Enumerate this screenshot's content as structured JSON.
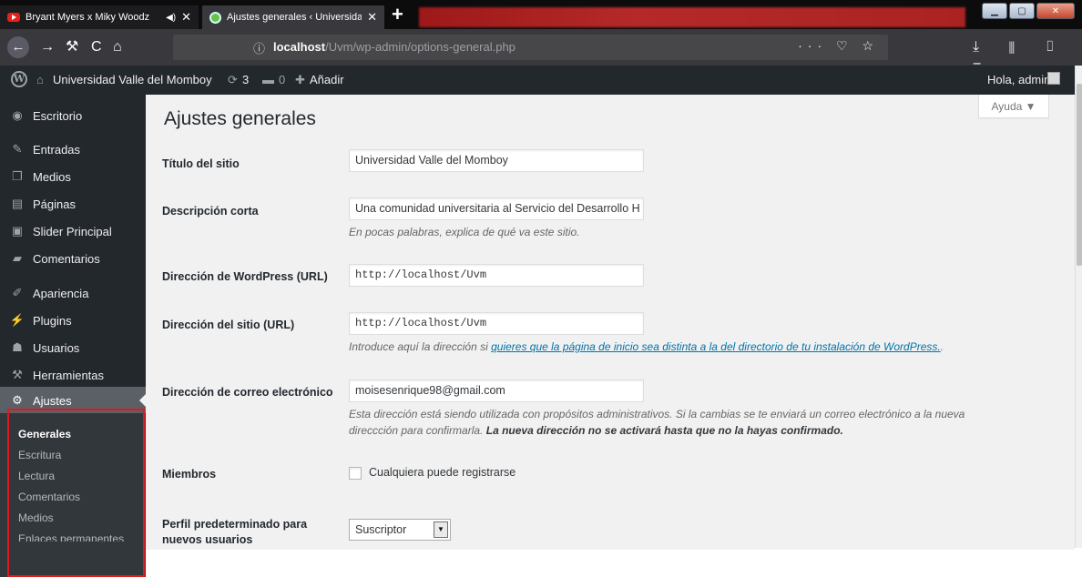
{
  "browser": {
    "tabs": [
      {
        "label": "Bryant Myers x Miky Woodz",
        "icon": "youtube-icon",
        "audio": true
      },
      {
        "label": "Ajustes generales ‹ Universidad",
        "icon": "globe-icon"
      }
    ],
    "url_host": "localhost",
    "url_path": "/Uvm/wp-admin/options-general.php",
    "url_actions": "··· ♡ ☆",
    "nav_back": "←",
    "nav_forward": "→",
    "nav_reload": "C",
    "nav_home": "⌂",
    "nav_tools": "⚒",
    "toolbar_right": "⤓ ⫴ ▯ ≡",
    "new_tab": "+",
    "window_controls": {
      "minimize": "▁",
      "maximize": "▢",
      "close": "✕"
    }
  },
  "adminbar": {
    "site_name": "Universidad Valle del Momboy",
    "updates_count": "3",
    "comments_count": "0",
    "new_label": "Añadir",
    "greeting": "Hola, admin"
  },
  "sidebar": {
    "items": [
      {
        "label": "Escritorio",
        "icon": "dashboard-icon",
        "glyph": "◉"
      },
      {
        "label": "Entradas",
        "icon": "pin-icon",
        "glyph": "✎"
      },
      {
        "label": "Medios",
        "icon": "media-icon",
        "glyph": "❐"
      },
      {
        "label": "Páginas",
        "icon": "pages-icon",
        "glyph": "▤"
      },
      {
        "label": "Slider Principal",
        "icon": "slider-icon",
        "glyph": "▣"
      },
      {
        "label": "Comentarios",
        "icon": "comments-icon",
        "glyph": "▰"
      },
      {
        "label": "Apariencia",
        "icon": "brush-icon",
        "glyph": "✐"
      },
      {
        "label": "Plugins",
        "icon": "plug-icon",
        "glyph": "⚡"
      },
      {
        "label": "Usuarios",
        "icon": "users-icon",
        "glyph": "☗"
      },
      {
        "label": "Herramientas",
        "icon": "wrench-icon",
        "glyph": "⚒"
      },
      {
        "label": "Ajustes",
        "icon": "settings-icon",
        "glyph": "⚙"
      }
    ],
    "submenu": [
      "Generales",
      "Escritura",
      "Lectura",
      "Comentarios",
      "Medios",
      "Enlaces permanentes"
    ]
  },
  "main": {
    "help_label": "Ayuda ▼",
    "page_title": "Ajustes generales",
    "fields": {
      "site_title": {
        "label": "Título del sitio",
        "value": "Universidad Valle del Momboy"
      },
      "tagline": {
        "label": "Descripción corta",
        "value": "Una comunidad universitaria al Servicio del Desarrollo H",
        "desc": "En pocas palabras, explica de qué va este sitio."
      },
      "wp_url": {
        "label": "Dirección de WordPress (URL)",
        "value": "http://localhost/Uvm"
      },
      "site_url": {
        "label": "Dirección del sitio (URL)",
        "value": "http://localhost/Uvm",
        "desc_prefix": "Introduce aquí la dirección si ",
        "desc_link": "quieres que la página de inicio sea distinta a la del directorio de tu instalación de WordPress.",
        "desc_suffix": "."
      },
      "admin_email": {
        "label": "Dirección de correo electrónico",
        "value": "moisesenrique98@gmail.com",
        "desc_line1": "Esta dirección está siendo utilizada con propósitos administrativos. Si la cambias se te enviará un correo electrónico a la nueva",
        "desc_line2_prefix": "direccción para confirmarla. ",
        "desc_line2_bold": "La nueva dirección no se activará hasta que no la hayas confirmado."
      },
      "membership": {
        "label": "Miembros",
        "checkbox_label": "Cualquiera puede registrarse",
        "checked": false
      },
      "default_role": {
        "label_line1": "Perfil predeterminado para",
        "label_line2": "nuevos usuarios",
        "value": "Suscriptor"
      }
    }
  },
  "colors": {
    "wp_sidebar": "#23282d",
    "wp_submenu": "#32373c",
    "wp_active": "#5b6066",
    "content_bg": "#f1f1f1",
    "link": "#0073aa",
    "annotation_red": "#e2191c"
  }
}
